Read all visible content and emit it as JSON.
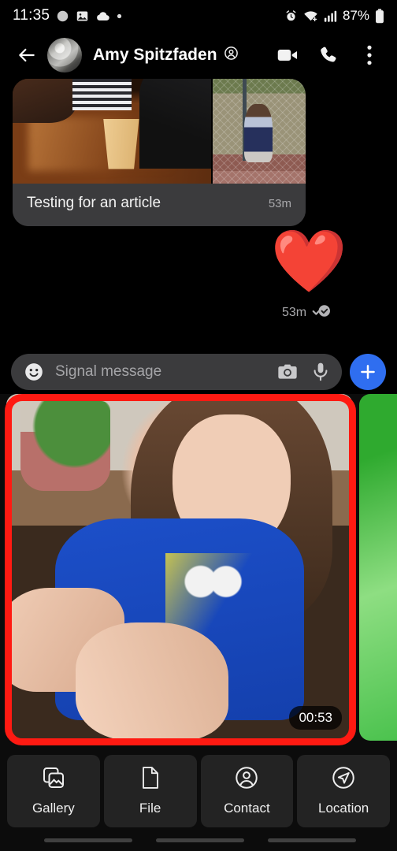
{
  "status_bar": {
    "time": "11:35",
    "battery": "87%",
    "left_icons": [
      "signal-app-icon",
      "image-icon",
      "cloud-icon",
      "dot-icon"
    ],
    "right_icons": [
      "alarm-icon",
      "wifi-icon",
      "cellular-signal-icon",
      "battery-icon"
    ]
  },
  "toolbar": {
    "back_icon": "back-arrow-icon",
    "contact_name": "Amy Spitzfaden",
    "name_badge_icon": "contact-badge-icon",
    "video_call_icon": "video-call-icon",
    "voice_call_icon": "phone-call-icon",
    "overflow_icon": "overflow-menu-icon"
  },
  "conversation": {
    "incoming_message": {
      "caption": "Testing for an article",
      "timestamp": "53m",
      "attachment_count": 2
    },
    "outgoing_message": {
      "emoji": "❤️",
      "timestamp": "53m",
      "delivery_status_icon": "read-receipt-icon"
    }
  },
  "compose": {
    "emoji_icon": "emoji-smiley-icon",
    "placeholder": "Signal message",
    "camera_icon": "camera-icon",
    "microphone_icon": "microphone-icon",
    "plus_icon": "plus-icon",
    "plus_color": "#2f6ef0"
  },
  "media_keyboard": {
    "selected_item": {
      "duration": "00:53",
      "highlight_color": "#ff1a12"
    },
    "attachments": [
      {
        "label": "Gallery",
        "icon": "gallery-icon"
      },
      {
        "label": "File",
        "icon": "file-icon"
      },
      {
        "label": "Contact",
        "icon": "contact-icon"
      },
      {
        "label": "Location",
        "icon": "location-icon"
      }
    ]
  }
}
